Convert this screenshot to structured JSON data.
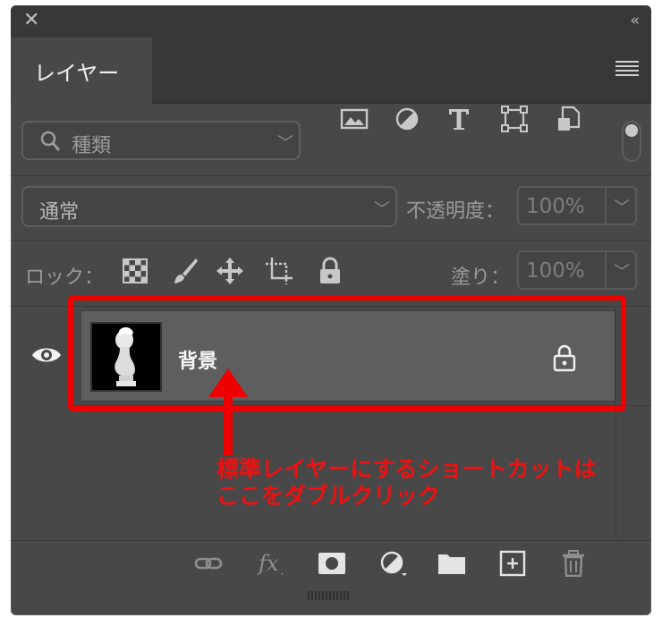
{
  "panel": {
    "tab_label": "レイヤー",
    "search_placeholder": "種類",
    "blend_mode": "通常",
    "opacity_label": "不透明度：",
    "opacity_value": "100%",
    "lock_label": "ロック：",
    "fill_label": "塗り：",
    "fill_value": "100%"
  },
  "layers": [
    {
      "name": "背景",
      "visible": true,
      "locked": true
    }
  ],
  "annotation": {
    "line1": "標準レイヤーにするショートカットは",
    "line2": "ここをダブルクリック",
    "color": "#ee0000"
  },
  "icons": {
    "filter": [
      "image-filter-icon",
      "adjustment-filter-icon",
      "type-filter-icon",
      "shape-filter-icon",
      "smart-object-filter-icon"
    ],
    "lock": [
      "lock-transparent-pixels-icon",
      "lock-image-pixels-icon",
      "lock-position-icon",
      "lock-artboard-icon",
      "lock-all-icon"
    ],
    "bottom": [
      "link-layers-icon",
      "fx-icon",
      "layer-mask-icon",
      "adjustment-layer-icon",
      "group-folder-icon",
      "new-layer-icon",
      "trash-icon"
    ]
  }
}
